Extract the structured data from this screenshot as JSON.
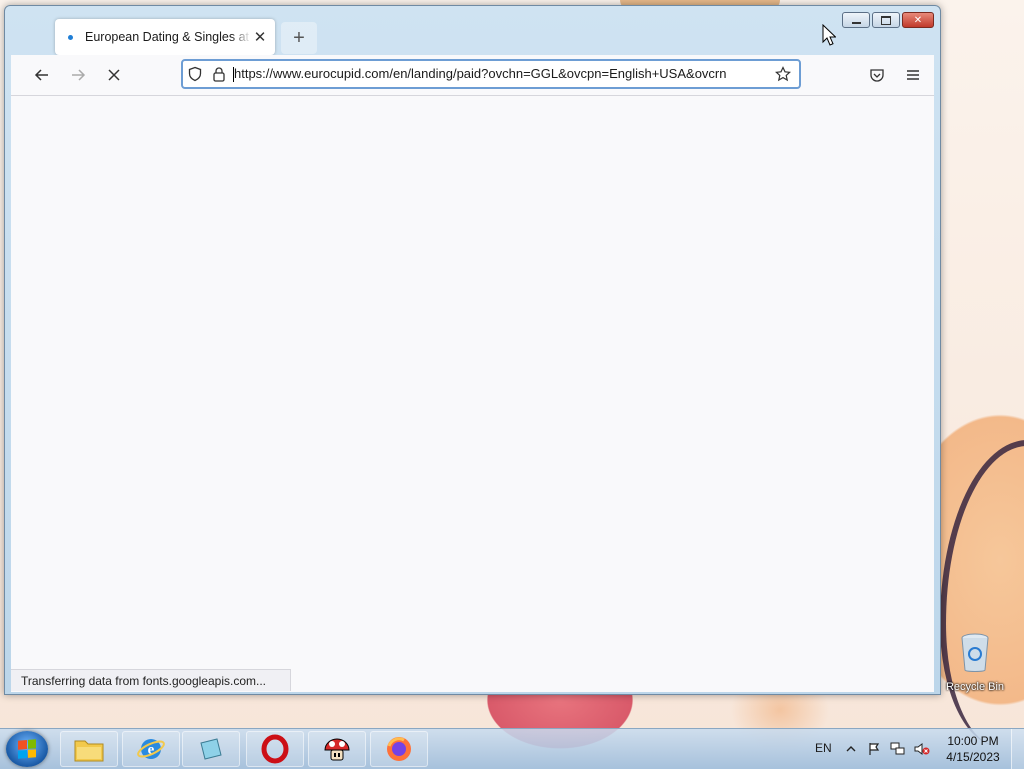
{
  "browser": {
    "tab": {
      "title": "European Dating & Singles at EuroCupid",
      "close": "✕",
      "new_tab": "+"
    },
    "url": "https://www.eurocupid.com/en/landing/paid?ovchn=GGL&ovcpn=English+USA&ovcrn",
    "status_text": "Transferring data from fonts.googleapis.com...",
    "window_controls": [
      "minimize",
      "maximize",
      "close"
    ]
  },
  "desktop": {
    "recycle_bin_label": "Recycle Bin"
  },
  "taskbar": {
    "language": "EN",
    "time": "10:00 PM",
    "date": "4/15/2023",
    "pinned": [
      "file-explorer",
      "internet-explorer",
      "notepad",
      "opera",
      "mushroom-app",
      "firefox"
    ]
  },
  "colors": {
    "accent": "#6d9dd4",
    "tab_dot": "#1f7ed6",
    "close_button": "#c0392b",
    "opera": "#cc0f16",
    "firefox": "#ff7139"
  }
}
